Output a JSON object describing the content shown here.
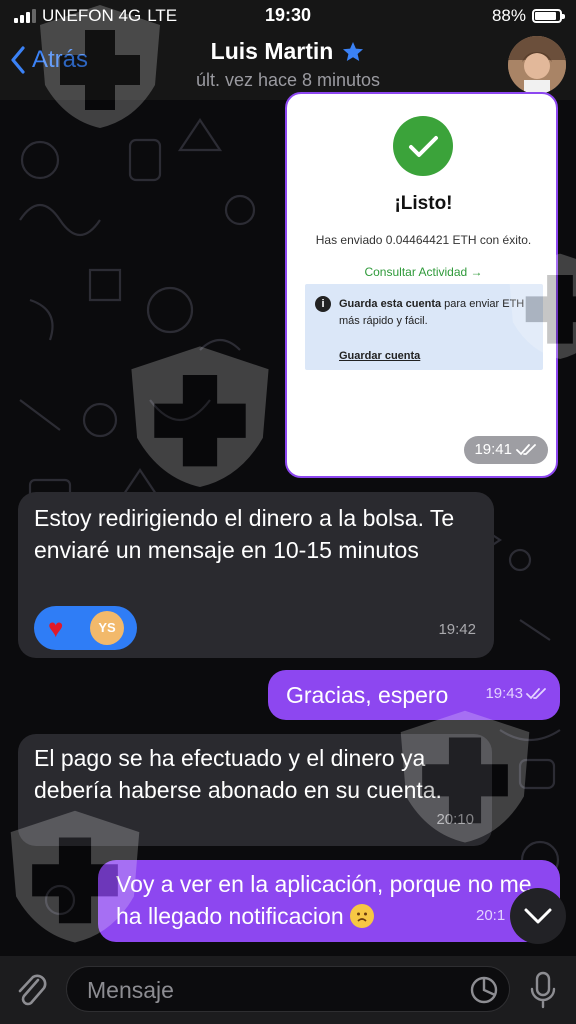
{
  "status_bar": {
    "carrier": "UNEFON 4G",
    "network": "LTE",
    "time": "19:30",
    "battery_percent": "88%",
    "battery_level": 0.88
  },
  "header": {
    "back_label": "Atrás",
    "contact_name": "Luis Martin",
    "last_seen": "últ. vez hace 8 minutos"
  },
  "messages": {
    "card": {
      "title": "¡Listo!",
      "text": "Has enviado 0.04464421 ETH con éxito.",
      "link": "Consultar Actividad →",
      "info_bold": "Guarda esta cuenta",
      "info_rest": " para enviar ETH más rápido y fácil.",
      "info_link": "Guardar cuenta",
      "time": "19:41"
    },
    "msg1": {
      "text": "Estoy redirigiendo el dinero a la bolsa. Te enviaré un mensaje en 10-15 minutos",
      "time": "19:42",
      "reaction_emoji": "♥",
      "reaction_user": "YS"
    },
    "msg2": {
      "text": "Gracias, espero",
      "time": "19:43"
    },
    "msg3": {
      "text": "El pago se ha efectuado y el dinero ya debería haberse abonado en su cuenta.",
      "time": "20:10"
    },
    "msg4": {
      "text": "Voy a ver en la aplicación, porque no me ha llegado notificacion",
      "time": "20:1"
    }
  },
  "input": {
    "placeholder": "Mensaje"
  },
  "colors": {
    "accent": "#8d47f0",
    "incoming": "#2a2a2f",
    "link_blue": "#3b82f6",
    "success_green": "#3ba33a"
  },
  "icons": [
    "chevron-left-icon",
    "star-icon",
    "checkmark-icon",
    "double-check-icon",
    "info-icon",
    "heart-icon",
    "chevron-down-icon",
    "paperclip-icon",
    "sticker-icon",
    "microphone-icon"
  ]
}
